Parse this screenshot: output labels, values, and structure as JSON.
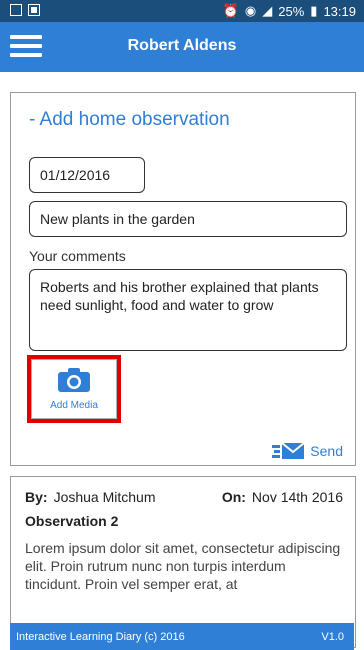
{
  "status_bar": {
    "time": "13:19",
    "battery": "25%"
  },
  "app_bar": {
    "title": "Robert Aldens",
    "menu_icon": "hamburger-menu-icon"
  },
  "form": {
    "heading": "- Add home observation",
    "date_value": "01/12/2016",
    "title_value": "New plants in the garden",
    "comments_label": "Your comments",
    "comments_value": "Roberts and his brother explained that plants need sunlight, food and water to grow",
    "add_media_label": "Add Media",
    "send_label": "Send"
  },
  "observation": {
    "by_label": "By:",
    "by_value": "Joshua Mitchum",
    "on_label": "On:",
    "on_value": "Nov 14th 2016",
    "title": "Observation 2",
    "body": "Lorem ipsum dolor sit amet, consectetur adipiscing elit. Proin rutrum nunc non turpis interdum tincidunt. Proin vel semper erat, at"
  },
  "footer": {
    "left": "Interactive Learning Diary (c) 2016",
    "right": "V1.0"
  },
  "colors": {
    "accent": "#2f7fd6",
    "status_bar": "#1b4e7a",
    "highlight": "#e00000"
  }
}
